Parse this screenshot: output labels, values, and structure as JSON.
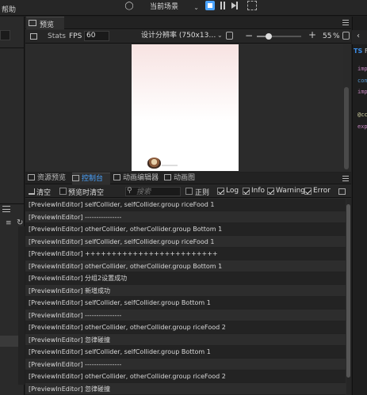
{
  "topbar": {
    "menu_help": "帮助",
    "scene_select": "当前场景"
  },
  "preview": {
    "tab_label": "预览",
    "stats_label": "Stats",
    "fps_label": "FPS",
    "fps_value": "60",
    "resolution_label": "设计分辨率 (750x13…",
    "zoom_value": "55",
    "zoom_unit": "%",
    "zoom_fraction": 0.27
  },
  "code_panel": {
    "file_badge": "TS",
    "file_name": "F",
    "lines": [
      {
        "text": "imp",
        "color": "#c586c0"
      },
      {
        "text": "con",
        "color": "#569cd6"
      },
      {
        "text": "imp",
        "color": "#c586c0"
      },
      {
        "text": "",
        "color": "#ccc"
      },
      {
        "text": "@cc",
        "color": "#dcdcaa"
      },
      {
        "text": "exp",
        "color": "#c586c0"
      }
    ]
  },
  "bottom": {
    "tabs": [
      {
        "label": "资源预览",
        "active": false
      },
      {
        "label": "控制台",
        "active": true
      },
      {
        "label": "动画编辑器",
        "active": false
      },
      {
        "label": "动画图",
        "active": false
      }
    ],
    "toolbar": {
      "clear_label": "清空",
      "clear_on_preview_label": "预览时清空",
      "clear_on_preview_checked": false,
      "search_placeholder": "搜索",
      "regex_label": "正则",
      "regex_checked": false,
      "log_label": "Log",
      "log_checked": true,
      "info_label": "Info",
      "info_checked": true,
      "warning_label": "Warning",
      "warning_checked": true,
      "error_label": "Error",
      "error_checked": true
    },
    "logs": [
      "[PreviewInEditor] selfCollider, selfCollider.group riceFood 1",
      "[PreviewInEditor] ----------------",
      "[PreviewInEditor] otherCollider, otherCollider.group Bottom 1",
      "[PreviewInEditor] selfCollider, selfCollider.group riceFood 1",
      "[PreviewInEditor] +++++++++++++++++++++++++",
      "[PreviewInEditor] otherCollider, otherCollider.group Bottom 1",
      "[PreviewInEditor] 分组2设置成功",
      "[PreviewInEditor] 新增成功",
      "[PreviewInEditor] selfCollider, selfCollider.group Bottom 1",
      "[PreviewInEditor] ----------------",
      "[PreviewInEditor] otherCollider, otherCollider.group riceFood 2",
      "[PreviewInEditor] 忽律碰撞",
      "[PreviewInEditor] selfCollider, selfCollider.group Bottom 1",
      "[PreviewInEditor] ----------------",
      "[PreviewInEditor] otherCollider, otherCollider.group riceFood 2",
      "[PreviewInEditor] 忽律碰撞"
    ]
  },
  "colors": {
    "accent": "#4aa3ff",
    "background": "#1f1f1f",
    "panel": "#2b2b2b"
  }
}
